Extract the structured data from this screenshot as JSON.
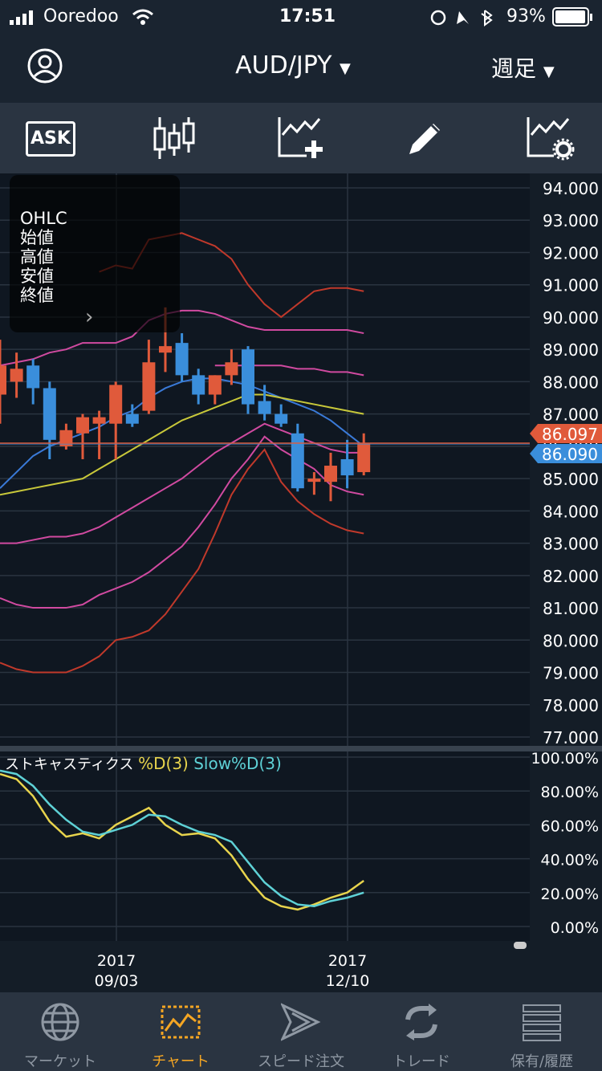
{
  "status": {
    "carrier": "Ooredoo",
    "time": "17:51",
    "battery": "93%"
  },
  "header": {
    "pair": "AUD/JPY",
    "timeframe": "週足"
  },
  "toolbar": {
    "ask_label": "ASK"
  },
  "ohlc_panel": {
    "title": "OHLC",
    "open": "始値",
    "high": "高値",
    "low": "安値",
    "close": "終値",
    "more": "›"
  },
  "price_axis": [
    "94.000",
    "93.000",
    "92.000",
    "91.000",
    "90.000",
    "89.000",
    "88.000",
    "87.000",
    "86.000",
    "85.000",
    "84.000",
    "83.000",
    "82.000",
    "81.000",
    "80.000",
    "79.000",
    "78.000",
    "77.000"
  ],
  "price_tags": {
    "ask": "86.097",
    "bid": "86.090",
    "ask_color": "#e05a3b",
    "bid_color": "#3a8edb"
  },
  "stoch": {
    "title": "ストキャスティクス",
    "d_label": "%D(3)",
    "slow_label": "Slow%D(3)",
    "d_color": "#e8d44d",
    "slow_color": "#5ed1d6",
    "axis": [
      "100.00%",
      "80.00%",
      "60.00%",
      "40.00%",
      "20.00%",
      "0.00%"
    ]
  },
  "time_axis": [
    {
      "year": "2017",
      "date": "09/03"
    },
    {
      "year": "2017",
      "date": "12/10"
    }
  ],
  "tabs": [
    {
      "label": "マーケット",
      "icon": "globe-icon"
    },
    {
      "label": "チャート",
      "icon": "chart-icon"
    },
    {
      "label": "スピード注文",
      "icon": "speed-icon"
    },
    {
      "label": "トレード",
      "icon": "refresh-icon"
    },
    {
      "label": "保有/履歴",
      "icon": "list-icon"
    }
  ],
  "chart_data": {
    "type": "candlestick",
    "ylim": [
      77,
      94
    ],
    "candles": [
      {
        "o": 87.6,
        "h": 89.3,
        "l": 86.7,
        "c": 88.5
      },
      {
        "o": 88.0,
        "h": 88.9,
        "l": 87.5,
        "c": 88.4
      },
      {
        "o": 88.5,
        "h": 88.7,
        "l": 87.3,
        "c": 87.8
      },
      {
        "o": 87.8,
        "h": 88.0,
        "l": 85.6,
        "c": 86.2
      },
      {
        "o": 86.0,
        "h": 86.7,
        "l": 85.9,
        "c": 86.5
      },
      {
        "o": 86.4,
        "h": 87.0,
        "l": 85.6,
        "c": 86.9
      },
      {
        "o": 86.7,
        "h": 87.1,
        "l": 85.6,
        "c": 86.9
      },
      {
        "o": 86.7,
        "h": 88.0,
        "l": 85.6,
        "c": 87.9
      },
      {
        "o": 87.0,
        "h": 87.3,
        "l": 86.6,
        "c": 86.7
      },
      {
        "o": 87.1,
        "h": 89.3,
        "l": 87.0,
        "c": 88.6
      },
      {
        "o": 88.9,
        "h": 90.3,
        "l": 88.3,
        "c": 89.1
      },
      {
        "o": 89.2,
        "h": 89.5,
        "l": 88.0,
        "c": 88.2
      },
      {
        "o": 88.2,
        "h": 88.4,
        "l": 87.3,
        "c": 87.6
      },
      {
        "o": 87.6,
        "h": 88.2,
        "l": 87.3,
        "c": 88.2
      },
      {
        "o": 88.2,
        "h": 89.0,
        "l": 87.9,
        "c": 88.6
      },
      {
        "o": 89.0,
        "h": 89.1,
        "l": 87.0,
        "c": 87.3
      },
      {
        "o": 87.4,
        "h": 87.9,
        "l": 86.8,
        "c": 87.0
      },
      {
        "o": 87.0,
        "h": 87.3,
        "l": 86.6,
        "c": 86.7
      },
      {
        "o": 86.4,
        "h": 86.7,
        "l": 84.6,
        "c": 84.7
      },
      {
        "o": 84.9,
        "h": 85.2,
        "l": 84.5,
        "c": 85.0
      },
      {
        "o": 84.9,
        "h": 85.8,
        "l": 84.3,
        "c": 85.4
      },
      {
        "o": 85.6,
        "h": 86.2,
        "l": 84.7,
        "c": 85.1
      },
      {
        "o": 85.2,
        "h": 86.4,
        "l": 85.1,
        "c": 86.1
      }
    ],
    "bands": {
      "upper3": [
        null,
        null,
        null,
        null,
        null,
        null,
        91.4,
        91.6,
        91.5,
        92.4,
        92.5,
        92.6,
        92.4,
        92.2,
        91.8,
        91.0,
        90.4,
        90.0,
        90.4,
        90.8,
        90.9,
        90.9,
        90.8
      ],
      "upper2": [
        88.5,
        88.6,
        88.7,
        88.9,
        89.0,
        89.2,
        89.2,
        89.2,
        89.4,
        89.9,
        90.1,
        90.2,
        90.2,
        90.1,
        89.9,
        89.7,
        89.6,
        89.6,
        89.6,
        89.6,
        89.6,
        89.6,
        89.5
      ],
      "upper1": [
        null,
        null,
        null,
        null,
        null,
        null,
        null,
        null,
        null,
        null,
        null,
        null,
        null,
        88.5,
        88.5,
        88.5,
        88.5,
        88.5,
        88.4,
        88.4,
        88.3,
        88.3,
        88.2
      ],
      "mid_blue": [
        84.7,
        85.2,
        85.7,
        86.0,
        86.2,
        86.4,
        86.6,
        86.9,
        87.1,
        87.5,
        87.8,
        88.0,
        88.1,
        88.1,
        88.0,
        87.9,
        87.7,
        87.5,
        87.3,
        87.1,
        86.8,
        86.4,
        86.0
      ],
      "sma": [
        84.5,
        84.6,
        84.7,
        84.8,
        84.9,
        85.0,
        85.3,
        85.6,
        85.9,
        86.2,
        86.5,
        86.8,
        87.0,
        87.2,
        87.4,
        87.6,
        87.6,
        87.5,
        87.4,
        87.3,
        87.2,
        87.1,
        87.0
      ],
      "lower1": [
        83.0,
        83.0,
        83.1,
        83.2,
        83.2,
        83.3,
        83.5,
        83.8,
        84.1,
        84.4,
        84.7,
        85.0,
        85.4,
        85.8,
        86.1,
        86.4,
        86.7,
        86.5,
        86.3,
        86.1,
        85.9,
        85.8,
        85.8
      ],
      "lower2": [
        81.3,
        81.1,
        81.0,
        81.0,
        81.0,
        81.1,
        81.4,
        81.6,
        81.8,
        82.1,
        82.5,
        82.9,
        83.5,
        84.2,
        85.0,
        85.6,
        86.3,
        85.9,
        85.6,
        85.3,
        84.8,
        84.6,
        84.5
      ],
      "lower3": [
        79.3,
        79.1,
        79.0,
        79.0,
        79.0,
        79.2,
        79.5,
        80.0,
        80.1,
        80.3,
        80.8,
        81.5,
        82.2,
        83.3,
        84.5,
        85.3,
        85.9,
        84.9,
        84.3,
        83.9,
        83.6,
        83.4,
        83.3
      ]
    },
    "stochastic": {
      "d": [
        90,
        87,
        77,
        62,
        53,
        55,
        52,
        60,
        65,
        70,
        60,
        54,
        55,
        52,
        42,
        28,
        17,
        12,
        10,
        13,
        17,
        20,
        27
      ],
      "slow": [
        92,
        90,
        83,
        72,
        63,
        56,
        54,
        57,
        60,
        66,
        65,
        60,
        56,
        54,
        50,
        38,
        26,
        18,
        13,
        12,
        15,
        17,
        20
      ]
    }
  }
}
